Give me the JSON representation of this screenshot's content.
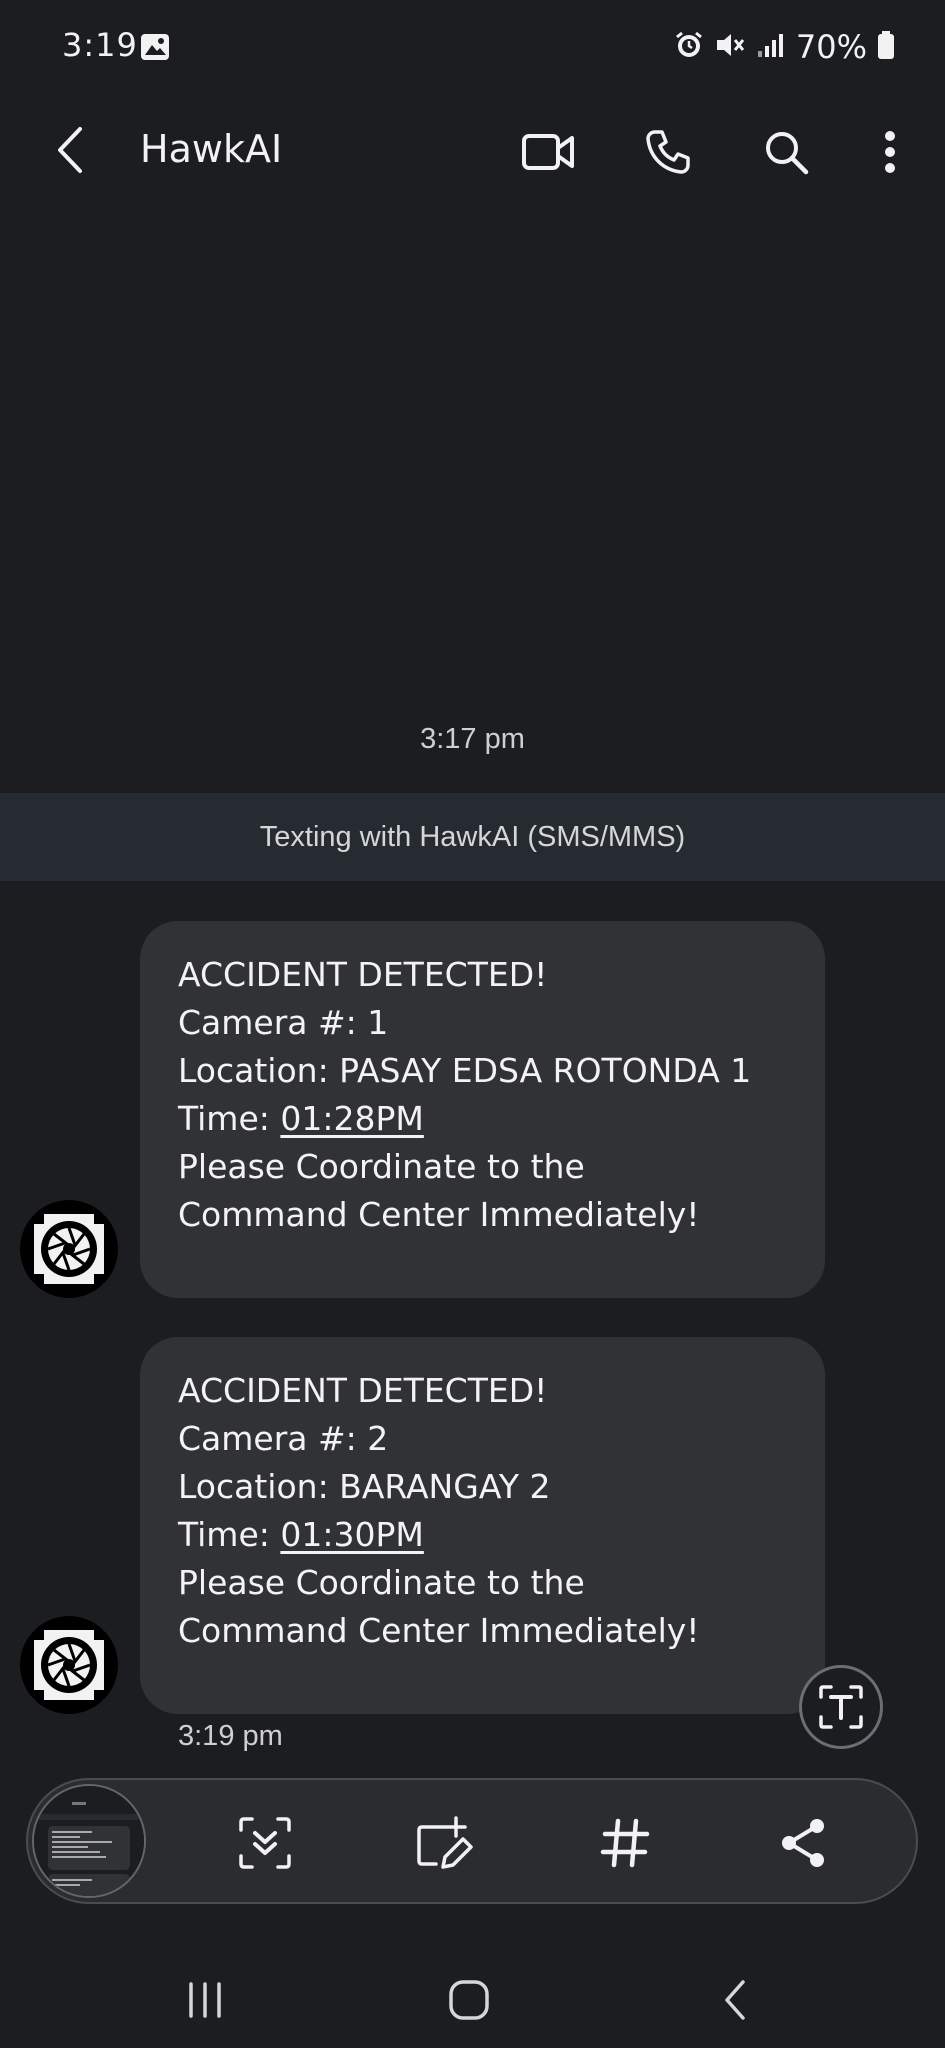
{
  "status_bar": {
    "time": "3:19",
    "battery": "70%"
  },
  "header": {
    "contact_name": "HawkAI"
  },
  "conversation": {
    "date_stamp": "3:17 pm",
    "banner": "Texting with HawkAI (SMS/MMS)",
    "messages": [
      {
        "lines": [
          "ACCIDENT DETECTED!",
          "Camera #: 1",
          "Location: PASAY EDSA ROTONDA 1"
        ],
        "time_prefix": "Time: ",
        "time_value": "01:28PM",
        "closing": [
          "Please Coordinate to the",
          "Command Center Immediately!"
        ]
      },
      {
        "lines": [
          "ACCIDENT DETECTED!",
          "Camera #: 2",
          "Location: BARANGAY 2"
        ],
        "time_prefix": "Time: ",
        "time_value": "01:30PM",
        "closing": [
          "Please Coordinate to the",
          "Command Center Immediately!"
        ]
      }
    ],
    "last_time": "3:19 pm"
  },
  "icons": {
    "back": "back-arrow-icon",
    "video": "video-call-icon",
    "phone": "phone-icon",
    "search": "search-icon",
    "more": "more-vertical-icon",
    "text_extract": "text-extract-icon",
    "scroll_capture": "scroll-capture-icon",
    "edit": "edit-screenshot-icon",
    "tag": "hashtag-icon",
    "share": "share-icon"
  },
  "colors": {
    "background": "#1b1d21",
    "bubble": "#313236",
    "banner": "#262b31"
  }
}
